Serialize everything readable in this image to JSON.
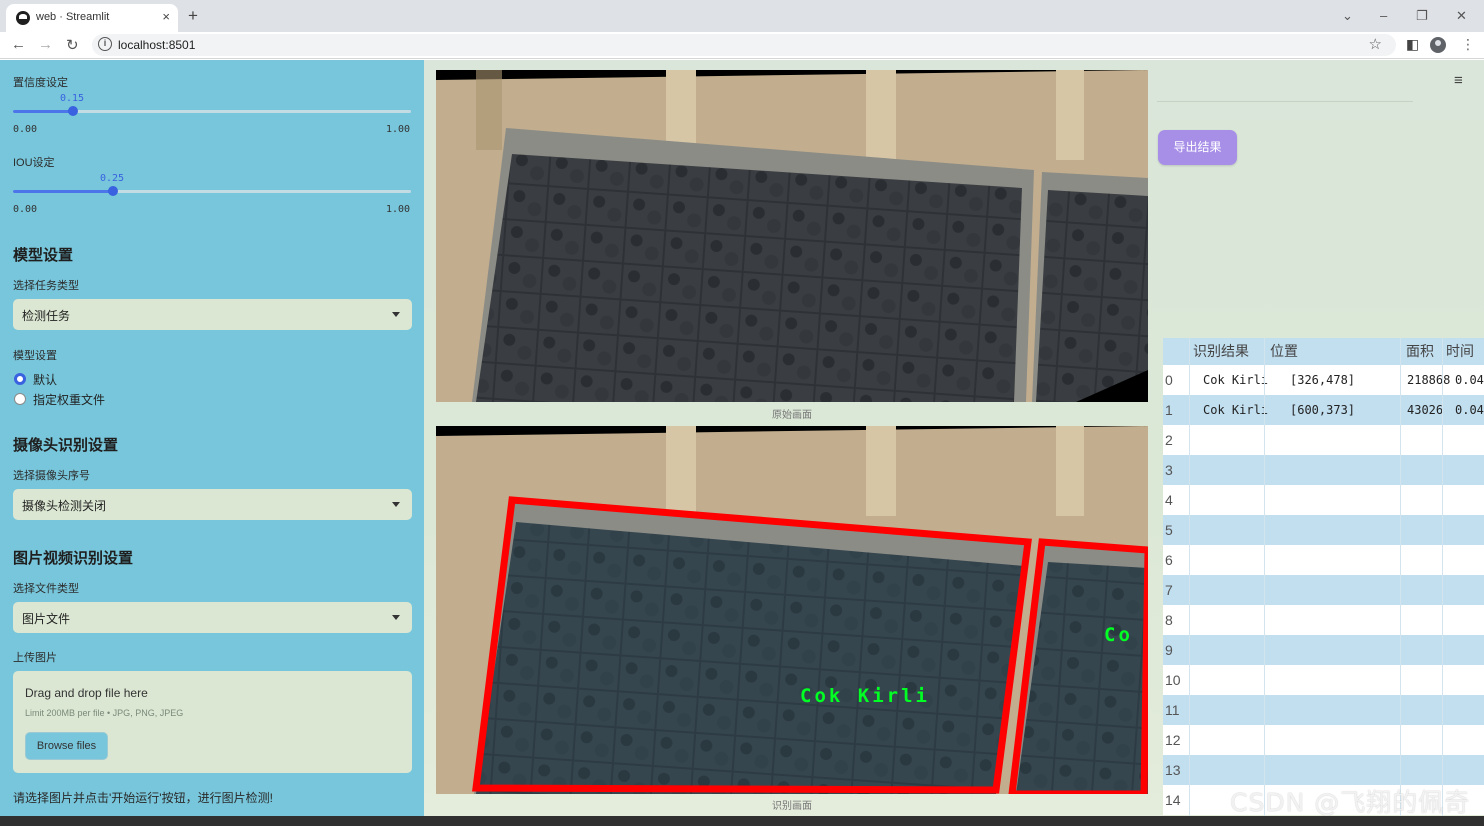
{
  "browser": {
    "tab_title": "web · Streamlit",
    "tab_close": "×",
    "new_tab": "+",
    "url": "localhost:8501",
    "win_min": "–",
    "win_restore": "❐",
    "win_close": "✕",
    "tab_search": "⌄"
  },
  "sidebar": {
    "conf_label": "置信度设定",
    "conf_value": "0.15",
    "conf_value_num": 0.15,
    "conf_min": "0.00",
    "conf_max": "1.00",
    "iou_label": "IOU设定",
    "iou_value": "0.25",
    "iou_value_num": 0.25,
    "iou_min": "0.00",
    "iou_max": "1.00",
    "model_section": "模型设置",
    "task_label": "选择任务类型",
    "task_value": "检测任务",
    "model_label": "模型设置",
    "radio_default": "默认",
    "radio_custom": "指定权重文件",
    "camera_section": "摄像头识别设置",
    "camera_label": "选择摄像头序号",
    "camera_value": "摄像头检测关闭",
    "media_section": "图片视频识别设置",
    "file_type_label": "选择文件类型",
    "file_type_value": "图片文件",
    "upload_label": "上传图片",
    "upload_title": "Drag and drop file here",
    "upload_limit": "Limit 200MB per file • JPG, PNG, JPEG",
    "browse_btn": "Browse files",
    "hint": "请选择图片并点击'开始运行'按钮，进行图片检测!"
  },
  "main": {
    "caption_original": "原始画面",
    "caption_result": "识别画面",
    "det_label_1": "Cok Kirli",
    "det_label_2": "Co"
  },
  "right": {
    "menu_icon": "≡",
    "export_btn": "导出结果",
    "table": {
      "headers": [
        "识别结果",
        "位置",
        "面积",
        "时间"
      ],
      "rows": [
        {
          "idx": "0",
          "result": "Cok Kirli",
          "pos": "[326,478]",
          "area": "218868",
          "time": "0.04"
        },
        {
          "idx": "1",
          "result": "Cok Kirli",
          "pos": "[600,373]",
          "area": "43026",
          "time": "0.04"
        },
        {
          "idx": "2"
        },
        {
          "idx": "3"
        },
        {
          "idx": "4"
        },
        {
          "idx": "5"
        },
        {
          "idx": "6"
        },
        {
          "idx": "7"
        },
        {
          "idx": "8"
        },
        {
          "idx": "9"
        },
        {
          "idx": "10"
        },
        {
          "idx": "11"
        },
        {
          "idx": "12"
        },
        {
          "idx": "13"
        },
        {
          "idx": "14"
        }
      ]
    },
    "watermark": "CSDN @飞翔的佩奇"
  },
  "colors": {
    "sidebar_bg": "#77c6db",
    "accent_blue": "#3a62e0",
    "export_purple": "#a78fe8",
    "box_red": "#ff0000",
    "label_green": "#00ff22",
    "table_stripe": "#c2dff0"
  }
}
